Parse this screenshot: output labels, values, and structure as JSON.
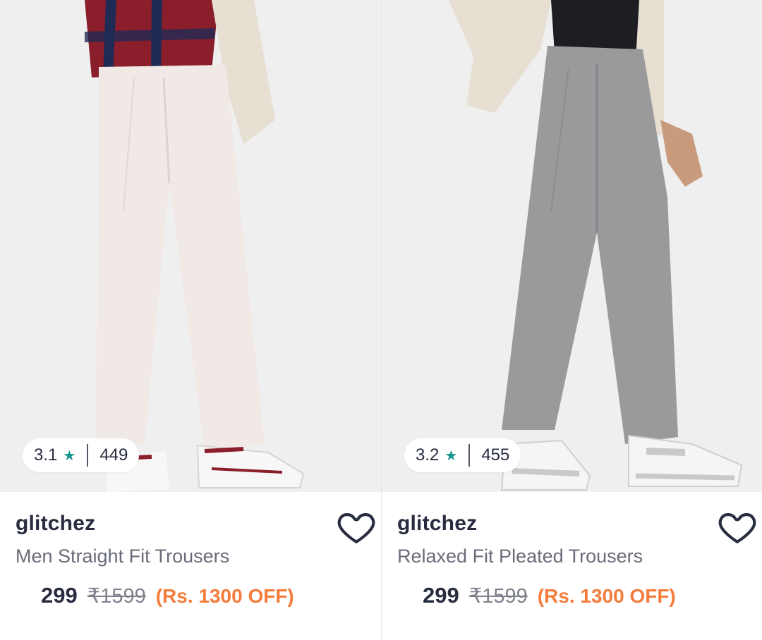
{
  "products": [
    {
      "rating": "3.1",
      "star_icon": "star-icon",
      "rating_count": "449",
      "brand": "glitchez",
      "title": "Men Straight Fit Trousers",
      "price": "299",
      "mrp": "₹1599",
      "discount": "(Rs. 1300 OFF)",
      "trouser_color": "#f1e9e6",
      "shirt_color": "#8b1e2b",
      "shoe_accent": "#8b1e2b"
    },
    {
      "rating": "3.2",
      "star_icon": "star-icon",
      "rating_count": "455",
      "brand": "glitchez",
      "title": "Relaxed Fit Pleated Trousers",
      "price": "299",
      "mrp": "₹1599",
      "discount": "(Rs. 1300 OFF)",
      "trouser_color": "#9a9a9c",
      "shirt_color": "#1e1e22",
      "shoe_accent": "#c9c9cc"
    }
  ],
  "colors": {
    "star": "#14958f",
    "discount": "#f47c3c",
    "brand_text": "#282c3f"
  }
}
